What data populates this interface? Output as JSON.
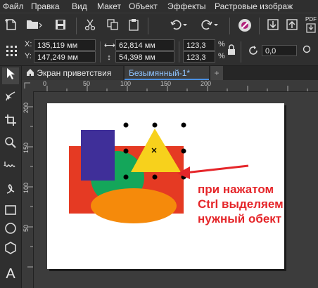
{
  "menu": [
    "Файл",
    "Правка",
    "Вид",
    "Макет",
    "Объект",
    "Эффекты",
    "Растровые изображ"
  ],
  "toolbar": {
    "pdf_label": "PDF"
  },
  "props": {
    "x_label": "X:",
    "x_value": "135,119 мм",
    "y_label": "Y:",
    "y_value": "147,249 мм",
    "w_value": "62,814 мм",
    "h_value": "54,398 мм",
    "sx_value": "123,3",
    "sy_value": "123,3",
    "pct1": "%",
    "pct2": "%",
    "angle_value": "0,0"
  },
  "tabs": {
    "welcome": "Экран приветствия",
    "document": "Безымянный-1*",
    "add": "+"
  },
  "ruler": {
    "h_ticks": [
      "0",
      "50",
      "100",
      "150",
      "200"
    ],
    "v_ticks": [
      "200",
      "150",
      "100",
      "50"
    ]
  },
  "annotation": {
    "line1": "при нажатом",
    "line2": "Ctrl выделяем",
    "line3": "нужный обект"
  },
  "colors": {
    "red": "#e53a23",
    "purple": "#3f2f99",
    "green": "#14a65a",
    "yellow": "#f7d11c",
    "orange": "#f58a0b"
  }
}
